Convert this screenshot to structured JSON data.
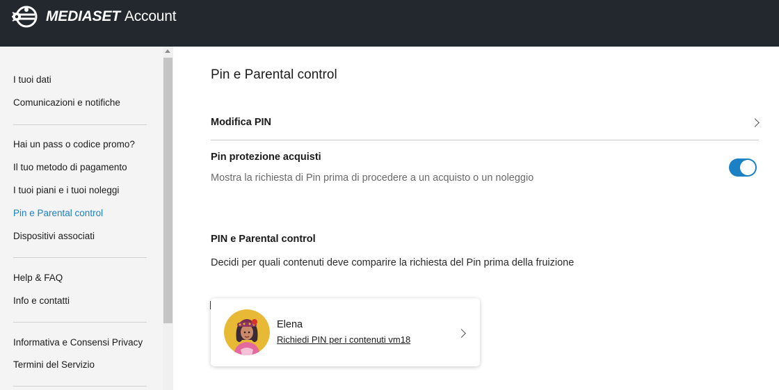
{
  "header": {
    "brand": "MEDIASET",
    "subtitle": "Account",
    "logo_icon": "mediaset-biscione-logo-icon"
  },
  "sidebar": {
    "items": [
      {
        "label": "I tuoi dati"
      },
      {
        "label": "Comunicazioni e notifiche"
      },
      {
        "label": "Hai un pass o codice promo?"
      },
      {
        "label": "Il tuo metodo di pagamento"
      },
      {
        "label": "I tuoi piani e i tuoi noleggi"
      },
      {
        "label": "Pin e Parental control",
        "active": true
      },
      {
        "label": "Dispositivi associati"
      },
      {
        "label": "Help & FAQ"
      },
      {
        "label": "Info e contatti"
      },
      {
        "label": "Informativa e Consensi Privacy"
      },
      {
        "label": "Termini del Servizio"
      }
    ]
  },
  "main": {
    "title": "Pin e Parental control",
    "modify_pin": {
      "label": "Modifica PIN"
    },
    "purchase_protection": {
      "label": "Pin protezione acquisti",
      "description": "Mostra la richiesta di Pin prima di procedere a un acquisto o un noleggio",
      "enabled": true
    },
    "parental": {
      "heading": "PIN e Parental control",
      "description": "Decidi per quali contenuti deve comparire la richiesta del Pin prima della fruizione"
    },
    "profile": {
      "name": "Elena",
      "link": "Richiedi PIN per i contenuti vm18"
    }
  },
  "colors": {
    "header_bg": "#23272e",
    "accent": "#1b80c4",
    "sidebar_bg": "#f4f4f4"
  }
}
